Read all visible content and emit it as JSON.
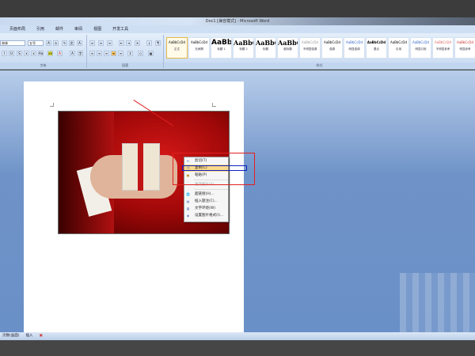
{
  "window": {
    "title": "Doc1 [兼容模式] - Microsoft Word"
  },
  "tabs": [
    "页面布局",
    "引用",
    "邮件",
    "审阅",
    "视图",
    "开发工具"
  ],
  "font": {
    "name": "宋体",
    "size": "五号"
  },
  "groups": {
    "font": "字体",
    "paragraph": "段落",
    "styles": "样式"
  },
  "styles": [
    {
      "sample": "AaBbCcDd",
      "name": "正文"
    },
    {
      "sample": "AaBbCcDd",
      "name": "无间隔"
    },
    {
      "sample": "AaBb",
      "name": "标题 1"
    },
    {
      "sample": "AaBbC",
      "name": "标题 2"
    },
    {
      "sample": "AaBbC",
      "name": "标题"
    },
    {
      "sample": "AaBbC",
      "name": "副标题"
    },
    {
      "sample": "AaBbCcDd",
      "name": "不明显强调"
    },
    {
      "sample": "AaBbCcDd",
      "name": "强调"
    },
    {
      "sample": "AaBbCcDd",
      "name": "明显强调"
    },
    {
      "sample": "AaBbCcDd",
      "name": "要点"
    },
    {
      "sample": "AaBbCcDd",
      "name": "引用"
    },
    {
      "sample": "AaBbCcDd",
      "name": "明显引用"
    },
    {
      "sample": "AaBbCcDd",
      "name": "不明显参考"
    },
    {
      "sample": "AaBbCcDd",
      "name": "明显参考"
    }
  ],
  "context_menu": [
    {
      "label": "剪切(T)",
      "icon": "scissors"
    },
    {
      "label": "复制(C)",
      "icon": "copy"
    },
    {
      "label": "粘贴(P)",
      "icon": "paste"
    },
    {
      "label": "更改图片(A)...",
      "icon": ""
    },
    {
      "label": "超链接(H)...",
      "icon": "link"
    },
    {
      "label": "插入题注(C)...",
      "icon": "caption"
    },
    {
      "label": "文字环绕(W)",
      "icon": "wrap"
    },
    {
      "label": "设置图片格式(I)...",
      "icon": "format"
    }
  ],
  "status": {
    "page": "页数(画面)",
    "mode": "插入"
  }
}
